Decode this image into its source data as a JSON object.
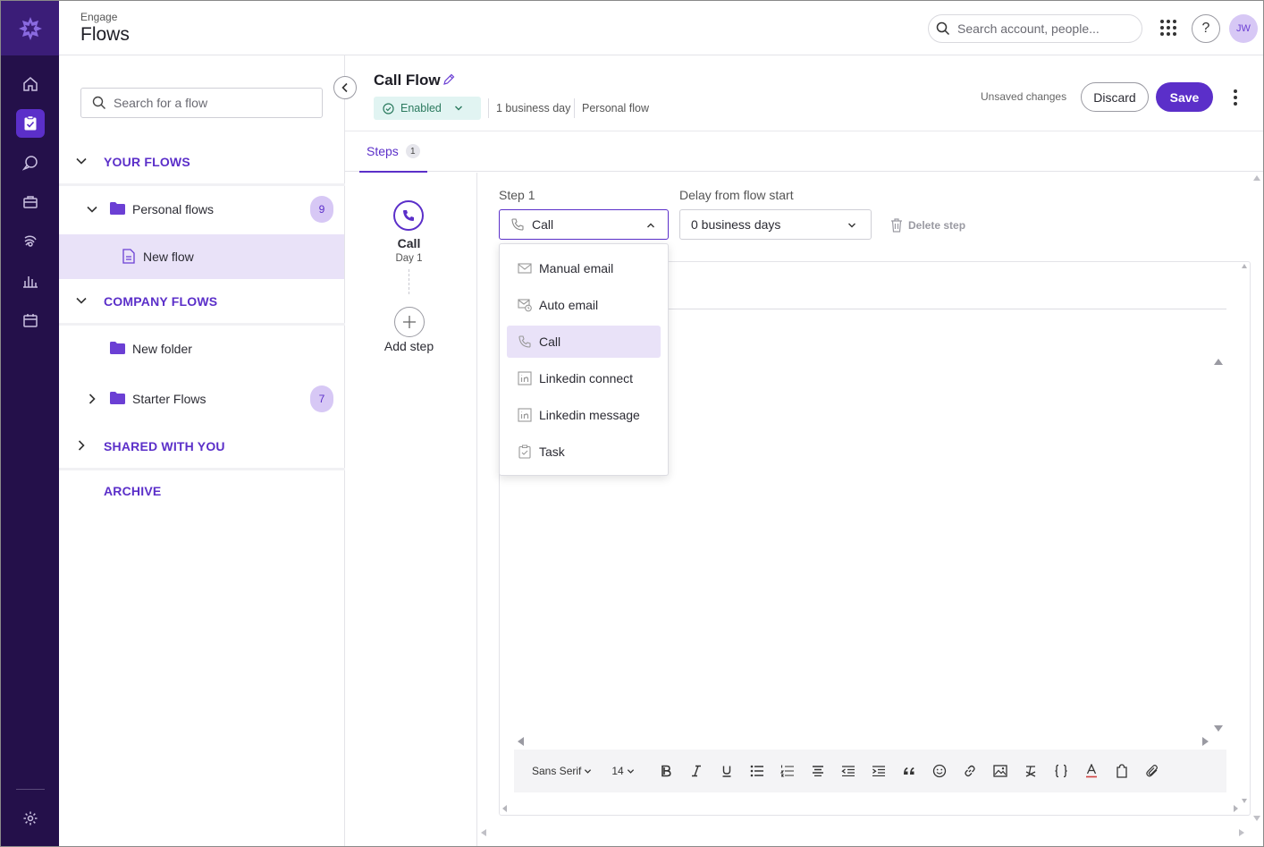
{
  "header": {
    "crumb": "Engage",
    "title": "Flows",
    "search_placeholder": "Search account, people...",
    "help_label": "?",
    "avatar_initials": "JW"
  },
  "sidebar": {
    "search_placeholder": "Search for a flow",
    "your_flows": "YOUR FLOWS",
    "personal_flows": "Personal flows",
    "personal_flows_count": "9",
    "new_flow": "New flow",
    "company_flows": "COMPANY FLOWS",
    "new_folder": "New folder",
    "starter_flows": "Starter Flows",
    "starter_flows_count": "7",
    "shared_with_you": "SHARED WITH YOU",
    "archive": "ARCHIVE"
  },
  "flow": {
    "title": "Call Flow",
    "status": "Enabled",
    "duration": "1 business day",
    "type": "Personal flow",
    "unsaved": "Unsaved changes",
    "discard": "Discard",
    "save": "Save"
  },
  "tabs": [
    {
      "label": "Steps",
      "count": "1"
    }
  ],
  "steps": [
    {
      "name": "Call",
      "day": "Day 1"
    }
  ],
  "add_step": "Add step",
  "step_editor": {
    "step_label": "Step 1",
    "type_value": "Call",
    "delay_label": "Delay from flow start",
    "delay_value": "0 business days",
    "delete_label": "Delete step"
  },
  "dropdown": {
    "items": [
      {
        "label": "Manual email",
        "icon": "mail-icon"
      },
      {
        "label": "Auto email",
        "icon": "auto-email-icon"
      },
      {
        "label": "Call",
        "icon": "phone-icon",
        "selected": true
      },
      {
        "label": "Linkedin connect",
        "icon": "linkedin-icon"
      },
      {
        "label": "Linkedin message",
        "icon": "linkedin-icon"
      },
      {
        "label": "Task",
        "icon": "task-icon"
      }
    ]
  },
  "toolbar": {
    "font": "Sans Serif",
    "size": "14"
  },
  "colors": {
    "accent": "#5b2fc9",
    "rail": "#24104a",
    "selected_bg": "#e9e2f8",
    "enabled_bg": "#e1f4f2"
  }
}
